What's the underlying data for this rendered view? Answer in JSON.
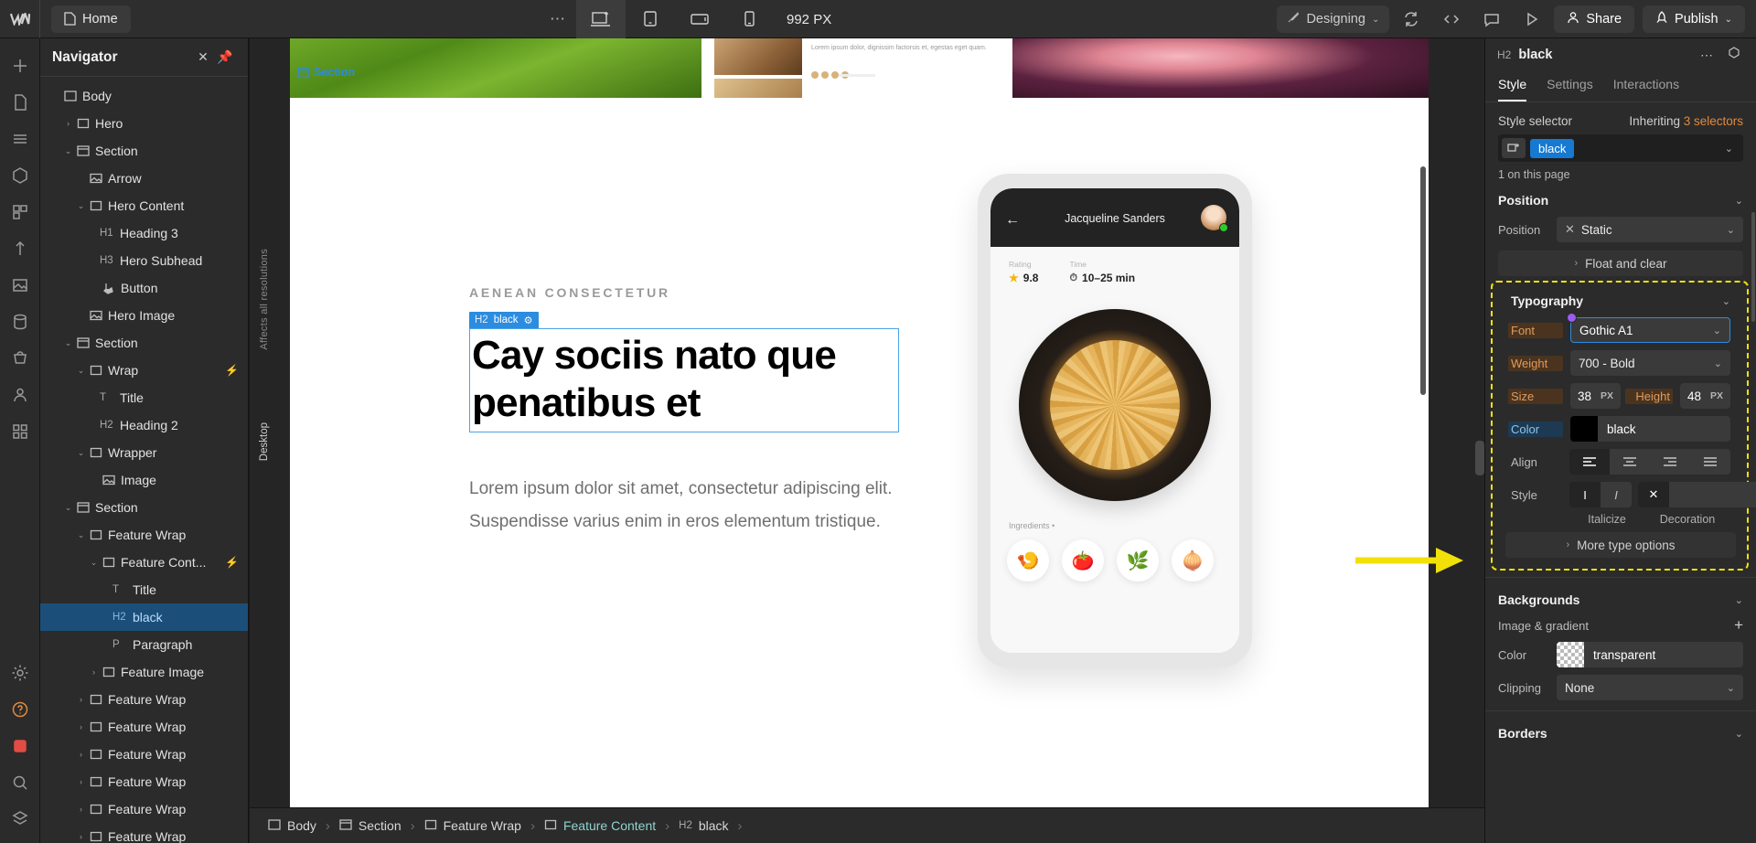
{
  "topbar": {
    "logo_icon": "webflow-logo",
    "home_tab": {
      "label": "Home",
      "icon": "page-icon"
    },
    "more_icon": "ellipsis-icon",
    "breakpoints": [
      {
        "name": "desktop",
        "icon": "desktop-icon",
        "active": true
      },
      {
        "name": "tablet",
        "icon": "tablet-icon",
        "active": false
      },
      {
        "name": "mobile-landscape",
        "icon": "mobile-landscape-icon",
        "active": false
      },
      {
        "name": "mobile-portrait",
        "icon": "mobile-portrait-icon",
        "active": false
      }
    ],
    "viewport_width": "992 PX",
    "mode": {
      "label": "Designing",
      "icon": "brush-icon",
      "caret": "⌄"
    },
    "refresh_icon": "refresh-icon",
    "code_icon": "code-icon",
    "comment_icon": "comment-icon",
    "preview_icon": "play-icon",
    "share": {
      "label": "Share",
      "icon": "person-icon"
    },
    "publish": {
      "label": "Publish",
      "icon": "rocket-icon",
      "caret": "⌄"
    }
  },
  "rail": {
    "icons": [
      "add-icon",
      "pages-icon",
      "navigator-icon",
      "components-icon",
      "variables-icon",
      "interactions-icon",
      "assets-icon",
      "cms-icon",
      "ecommerce-icon",
      "users-icon",
      "apps-icon"
    ],
    "bottom_icons": [
      "settings-icon",
      "help-icon",
      "video-icon",
      "search-icon",
      "apps-grid-icon"
    ]
  },
  "navigator": {
    "title": "Navigator",
    "close_icon": "close-icon",
    "pin_icon": "pin-icon",
    "tree": [
      {
        "tag": "",
        "label": "Body",
        "indent": 0,
        "icon": "body-icon",
        "twisty": "",
        "selected": false,
        "bolt": false
      },
      {
        "tag": "",
        "label": "Hero",
        "indent": 1,
        "icon": "div-icon",
        "twisty": "›",
        "selected": false,
        "bolt": false
      },
      {
        "tag": "",
        "label": "Section",
        "indent": 1,
        "icon": "section-icon",
        "twisty": "⌄",
        "selected": false,
        "bolt": false
      },
      {
        "tag": "",
        "label": "Arrow",
        "indent": 2,
        "icon": "image-icon",
        "twisty": "",
        "selected": false,
        "bolt": false
      },
      {
        "tag": "",
        "label": "Hero Content",
        "indent": 2,
        "icon": "div-icon",
        "twisty": "⌄",
        "selected": false,
        "bolt": false
      },
      {
        "tag": "H1",
        "label": "Heading 3",
        "indent": 3,
        "icon": "",
        "twisty": "",
        "selected": false,
        "bolt": false
      },
      {
        "tag": "H3",
        "label": "Hero Subhead",
        "indent": 3,
        "icon": "",
        "twisty": "",
        "selected": false,
        "bolt": false
      },
      {
        "tag": "",
        "label": "Button",
        "indent": 3,
        "icon": "button-icon",
        "twisty": "",
        "selected": false,
        "bolt": false
      },
      {
        "tag": "",
        "label": "Hero Image",
        "indent": 2,
        "icon": "image-icon",
        "twisty": "",
        "selected": false,
        "bolt": false
      },
      {
        "tag": "",
        "label": "Section",
        "indent": 1,
        "icon": "section-icon",
        "twisty": "⌄",
        "selected": false,
        "bolt": false
      },
      {
        "tag": "",
        "label": "Wrap",
        "indent": 2,
        "icon": "div-icon",
        "twisty": "⌄",
        "selected": false,
        "bolt": true
      },
      {
        "tag": "T",
        "label": "Title",
        "indent": 3,
        "icon": "",
        "twisty": "",
        "selected": false,
        "bolt": false
      },
      {
        "tag": "H2",
        "label": "Heading 2",
        "indent": 3,
        "icon": "",
        "twisty": "",
        "selected": false,
        "bolt": false
      },
      {
        "tag": "",
        "label": "Wrapper",
        "indent": 2,
        "icon": "div-icon",
        "twisty": "⌄",
        "selected": false,
        "bolt": false
      },
      {
        "tag": "",
        "label": "Image",
        "indent": 3,
        "icon": "image-icon",
        "twisty": "",
        "selected": false,
        "bolt": false
      },
      {
        "tag": "",
        "label": "Section",
        "indent": 1,
        "icon": "section-icon",
        "twisty": "⌄",
        "selected": false,
        "bolt": false
      },
      {
        "tag": "",
        "label": "Feature Wrap",
        "indent": 2,
        "icon": "div-icon",
        "twisty": "⌄",
        "selected": false,
        "bolt": false
      },
      {
        "tag": "",
        "label": "Feature Cont...",
        "indent": 3,
        "icon": "div-icon",
        "twisty": "⌄",
        "selected": false,
        "bolt": true
      },
      {
        "tag": "T",
        "label": "Title",
        "indent": 4,
        "icon": "",
        "twisty": "",
        "selected": false,
        "bolt": false
      },
      {
        "tag": "H2",
        "label": "black",
        "indent": 4,
        "icon": "",
        "twisty": "",
        "selected": true,
        "bolt": false
      },
      {
        "tag": "P",
        "label": "Paragraph",
        "indent": 4,
        "icon": "",
        "twisty": "",
        "selected": false,
        "bolt": false
      },
      {
        "tag": "",
        "label": "Feature Image",
        "indent": 3,
        "icon": "div-icon",
        "twisty": "›",
        "selected": false,
        "bolt": false
      },
      {
        "tag": "",
        "label": "Feature Wrap",
        "indent": 2,
        "icon": "div-icon",
        "twisty": "›",
        "selected": false,
        "bolt": false
      },
      {
        "tag": "",
        "label": "Feature Wrap",
        "indent": 2,
        "icon": "div-icon",
        "twisty": "›",
        "selected": false,
        "bolt": false
      },
      {
        "tag": "",
        "label": "Feature Wrap",
        "indent": 2,
        "icon": "div-icon",
        "twisty": "›",
        "selected": false,
        "bolt": false
      },
      {
        "tag": "",
        "label": "Feature Wrap",
        "indent": 2,
        "icon": "div-icon",
        "twisty": "›",
        "selected": false,
        "bolt": false
      },
      {
        "tag": "",
        "label": "Feature Wrap",
        "indent": 2,
        "icon": "div-icon",
        "twisty": "›",
        "selected": false,
        "bolt": false
      },
      {
        "tag": "",
        "label": "Feature Wrap",
        "indent": 2,
        "icon": "div-icon",
        "twisty": "›",
        "selected": false,
        "bolt": false
      }
    ]
  },
  "canvas": {
    "side_label_top": "Affects all resolutions",
    "side_label_bottom": "Desktop",
    "section_badge": "Section",
    "eyebrow": "AENEAN CONSECTETUR",
    "element_badge": {
      "tag": "H2",
      "name": "black",
      "gear_icon": "gear-icon"
    },
    "headline": "Cay sociis nato que penatibus et",
    "body_copy": "Lorem ipsum dolor sit amet, consectetur adipiscing elit. Suspendisse varius enim in eros elementum tristique.",
    "phone": {
      "back_icon": "back-arrow-icon",
      "user_name": "Jacqueline Sanders",
      "avatar": "user-avatar",
      "status_dot": "online-dot",
      "rating_label": "Rating",
      "rating_value": "9.8",
      "rating_icon": "star-icon",
      "time_label": "Time",
      "time_value": "10–25 min",
      "time_icon": "clock-icon",
      "ingredients_label": "Ingredients",
      "ingredients": [
        {
          "name": "shrimp",
          "glyph": "🍤"
        },
        {
          "name": "tomato",
          "glyph": "🍅"
        },
        {
          "name": "herbs",
          "glyph": "🌿"
        },
        {
          "name": "onion",
          "glyph": "🧅"
        }
      ]
    }
  },
  "right_panel": {
    "element_tag": "H2",
    "element_name": "black",
    "more_icon": "ellipsis-icon",
    "component_icon": "create-component-icon",
    "tabs": [
      {
        "label": "Style",
        "active": true
      },
      {
        "label": "Settings",
        "active": false
      },
      {
        "label": "Interactions",
        "active": false
      }
    ],
    "style_selector": {
      "label": "Style selector",
      "inheriting_prefix": "Inheriting ",
      "inheriting_count": "3 selectors",
      "chip": "black",
      "chip_icon": "selector-icon",
      "caret": "⌄",
      "on_page": "1 on this page"
    },
    "position": {
      "title": "Position",
      "caret": "⌄",
      "label": "Position",
      "value": "Static",
      "clear_icon": "x-icon",
      "float_and_clear": "Float and clear",
      "float_caret": "›"
    },
    "typography": {
      "title": "Typography",
      "caret": "⌄",
      "font_label": "Font",
      "font_value": "Gothic A1",
      "weight_label": "Weight",
      "weight_value": "700 - Bold",
      "size_label": "Size",
      "size_value": "38",
      "size_unit": "PX",
      "height_label": "Height",
      "height_value": "48",
      "height_unit": "PX",
      "color_label": "Color",
      "color_value": "black",
      "color_hex": "#000000",
      "align_label": "Align",
      "align_options": [
        "align-left",
        "align-center",
        "align-right",
        "align-justify"
      ],
      "align_active": 0,
      "style_label": "Style",
      "italicize_label": "Italicize",
      "decoration_label": "Decoration",
      "more_type_options": "More type options",
      "more_caret": "›"
    },
    "backgrounds": {
      "title": "Backgrounds",
      "caret": "⌄",
      "image_gradient_label": "Image & gradient",
      "add_icon": "plus-icon",
      "color_label": "Color",
      "color_value": "transparent",
      "clipping_label": "Clipping",
      "clipping_value": "None",
      "clipping_caret": "⌄"
    },
    "borders": {
      "title": "Borders",
      "caret": "⌄"
    }
  },
  "breadcrumb": [
    {
      "tag": "",
      "label": "Body",
      "icon": "body-icon",
      "teal": false
    },
    {
      "tag": "",
      "label": "Section",
      "icon": "section-icon",
      "teal": false
    },
    {
      "tag": "",
      "label": "Feature Wrap",
      "icon": "div-icon",
      "teal": false
    },
    {
      "tag": "",
      "label": "Feature Content",
      "icon": "div-icon",
      "teal": true
    },
    {
      "tag": "H2",
      "label": "black",
      "icon": "",
      "teal": false
    }
  ]
}
